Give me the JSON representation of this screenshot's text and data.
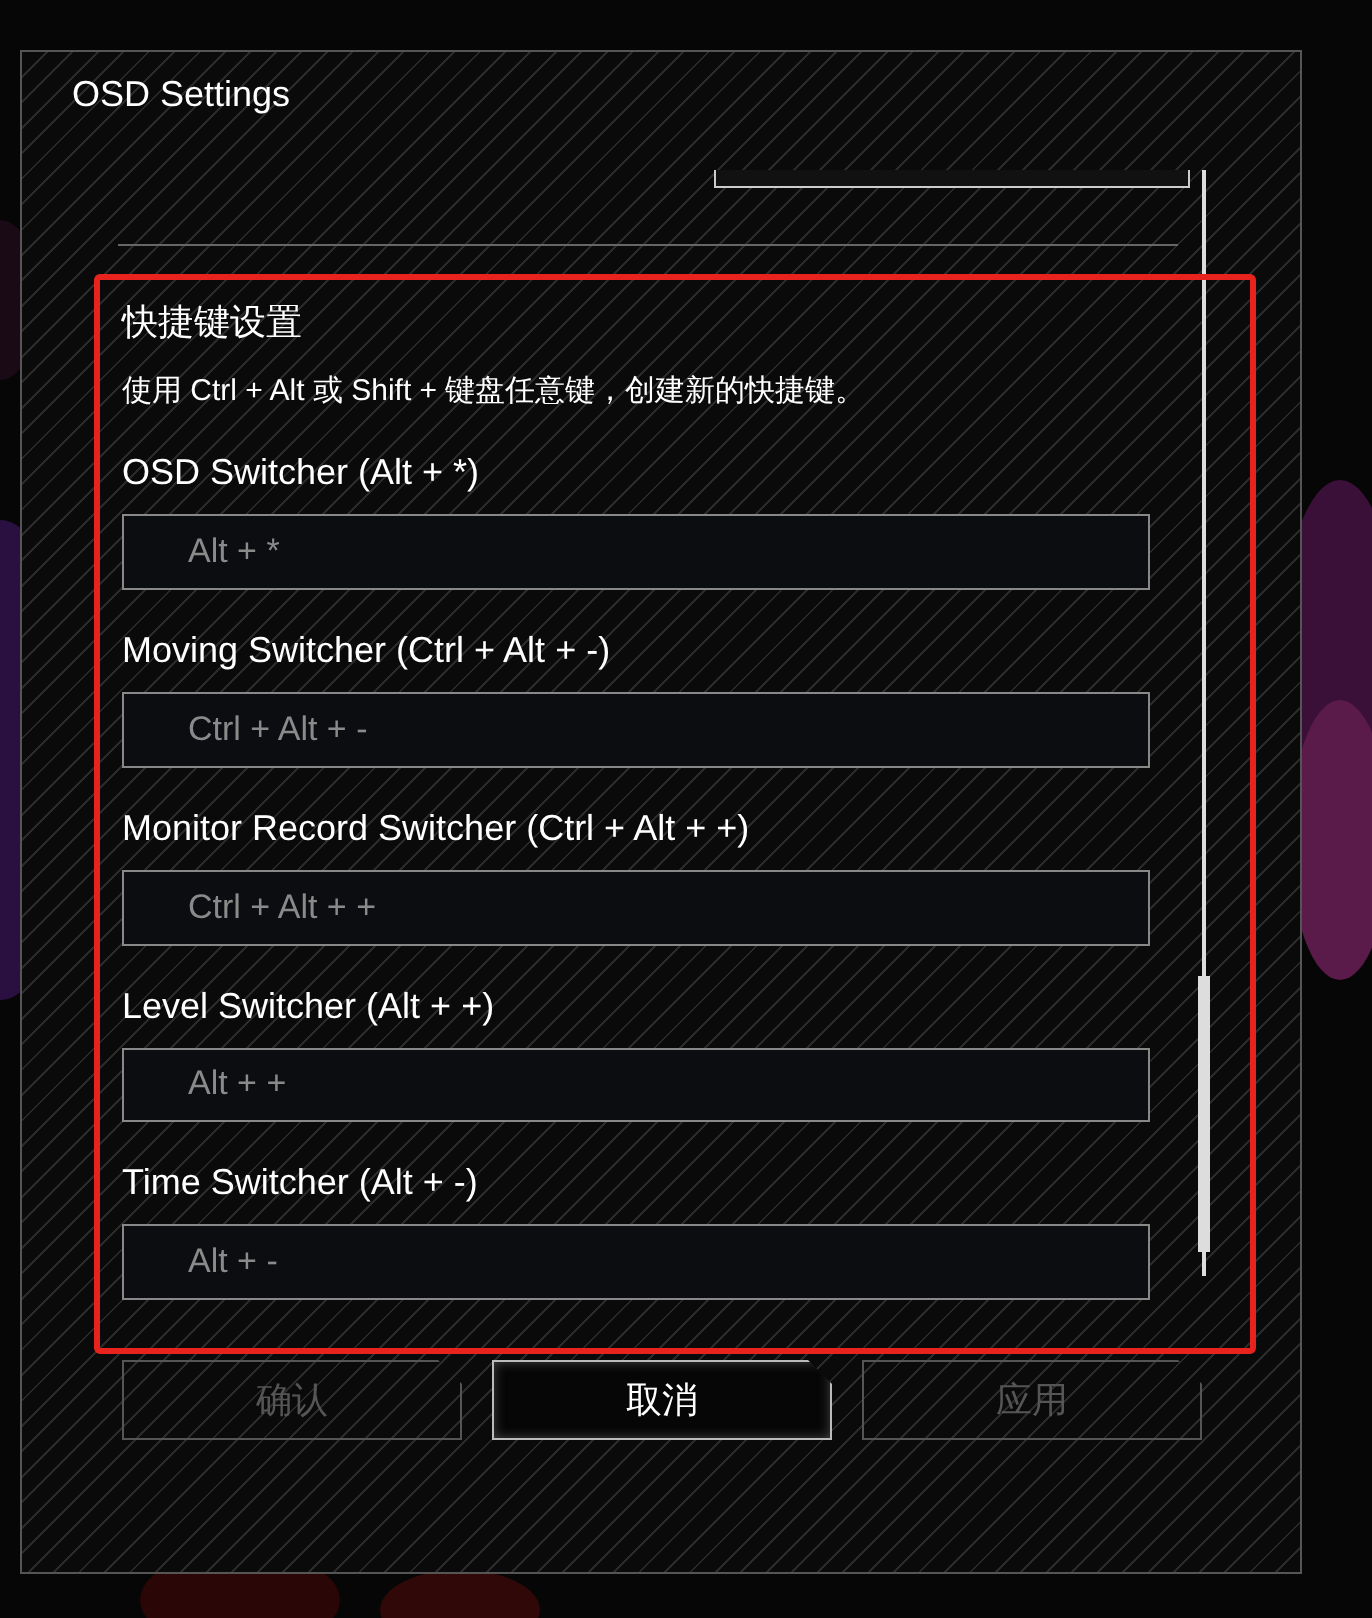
{
  "window": {
    "title": "OSD Settings"
  },
  "section": {
    "heading": "快捷键设置",
    "description": "使用 Ctrl + Alt 或 Shift + 键盘任意键，创建新的快捷键。"
  },
  "shortcuts": [
    {
      "label": "OSD Switcher (Alt + *)",
      "value": "Alt + *"
    },
    {
      "label": "Moving Switcher (Ctrl + Alt + -)",
      "value": "Ctrl + Alt + -"
    },
    {
      "label": "Monitor Record Switcher (Ctrl + Alt + +)",
      "value": "Ctrl + Alt + +"
    },
    {
      "label": "Level Switcher (Alt + +)",
      "value": "Alt + +"
    },
    {
      "label": "Time Switcher (Alt + -)",
      "value": "Alt + -"
    }
  ],
  "buttons": [
    {
      "label": "确认",
      "disabled": true
    },
    {
      "label": "取消",
      "disabled": false
    },
    {
      "label": "应用",
      "disabled": true
    }
  ]
}
